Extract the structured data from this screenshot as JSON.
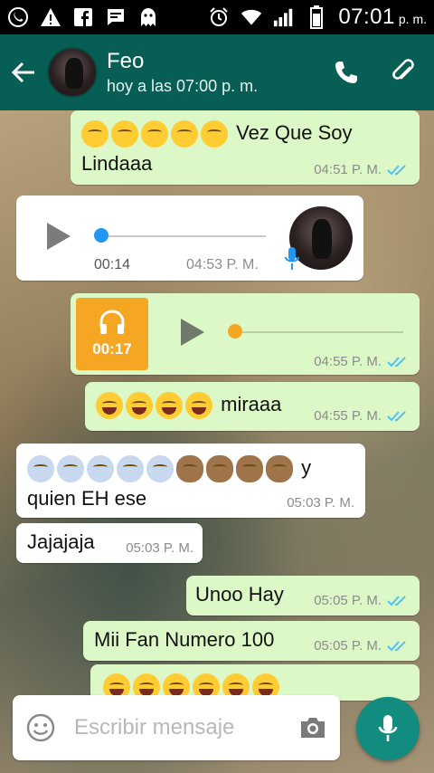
{
  "status_bar": {
    "time": "07:01",
    "ampm": "p. m."
  },
  "header": {
    "contact_name": "Feo",
    "last_seen": "hoy a las 07:00 p. m."
  },
  "messages": [
    {
      "type": "text",
      "direction": "out",
      "text": "Vez Que Soy Lindaaa",
      "time": "04:51 P. M."
    },
    {
      "type": "audio",
      "direction": "in",
      "duration": "00:14",
      "time": "04:53 P. M."
    },
    {
      "type": "audio",
      "direction": "out",
      "duration": "00:17",
      "time": "04:55 P. M."
    },
    {
      "type": "text",
      "direction": "out",
      "text": "miraaa",
      "time": "04:55 P. M."
    },
    {
      "type": "text",
      "direction": "in",
      "text": "y quien EH ese",
      "time": "05:03 P. M."
    },
    {
      "type": "text",
      "direction": "in",
      "text": "Jajajaja",
      "time": "05:03 P. M."
    },
    {
      "type": "text",
      "direction": "out",
      "text": "Unoo Hay",
      "time": "05:05 P. M."
    },
    {
      "type": "text",
      "direction": "out",
      "text": "Mii Fan Numero 100",
      "time": "05:05 P. M."
    }
  ],
  "input": {
    "placeholder": "Escribir mensaje"
  },
  "colors": {
    "header": "#075e54",
    "outgoing_bubble": "#dcf8c6",
    "incoming_bubble": "#ffffff",
    "read_ticks": "#4fc3f7",
    "audio_accent_in": "#2196f3",
    "audio_accent_out": "#f5a623",
    "fab": "#128c7e"
  },
  "icons": [
    "whatsapp-icon",
    "alert-icon",
    "facebook-icon",
    "message-icon",
    "ghost-icon",
    "alarm-icon",
    "wifi-icon",
    "signal-icon",
    "battery-icon",
    "back-arrow-icon",
    "phone-icon",
    "paperclip-icon",
    "play-icon",
    "headphones-icon",
    "mic-icon",
    "emoji-icon",
    "camera-icon",
    "double-check-icon"
  ]
}
